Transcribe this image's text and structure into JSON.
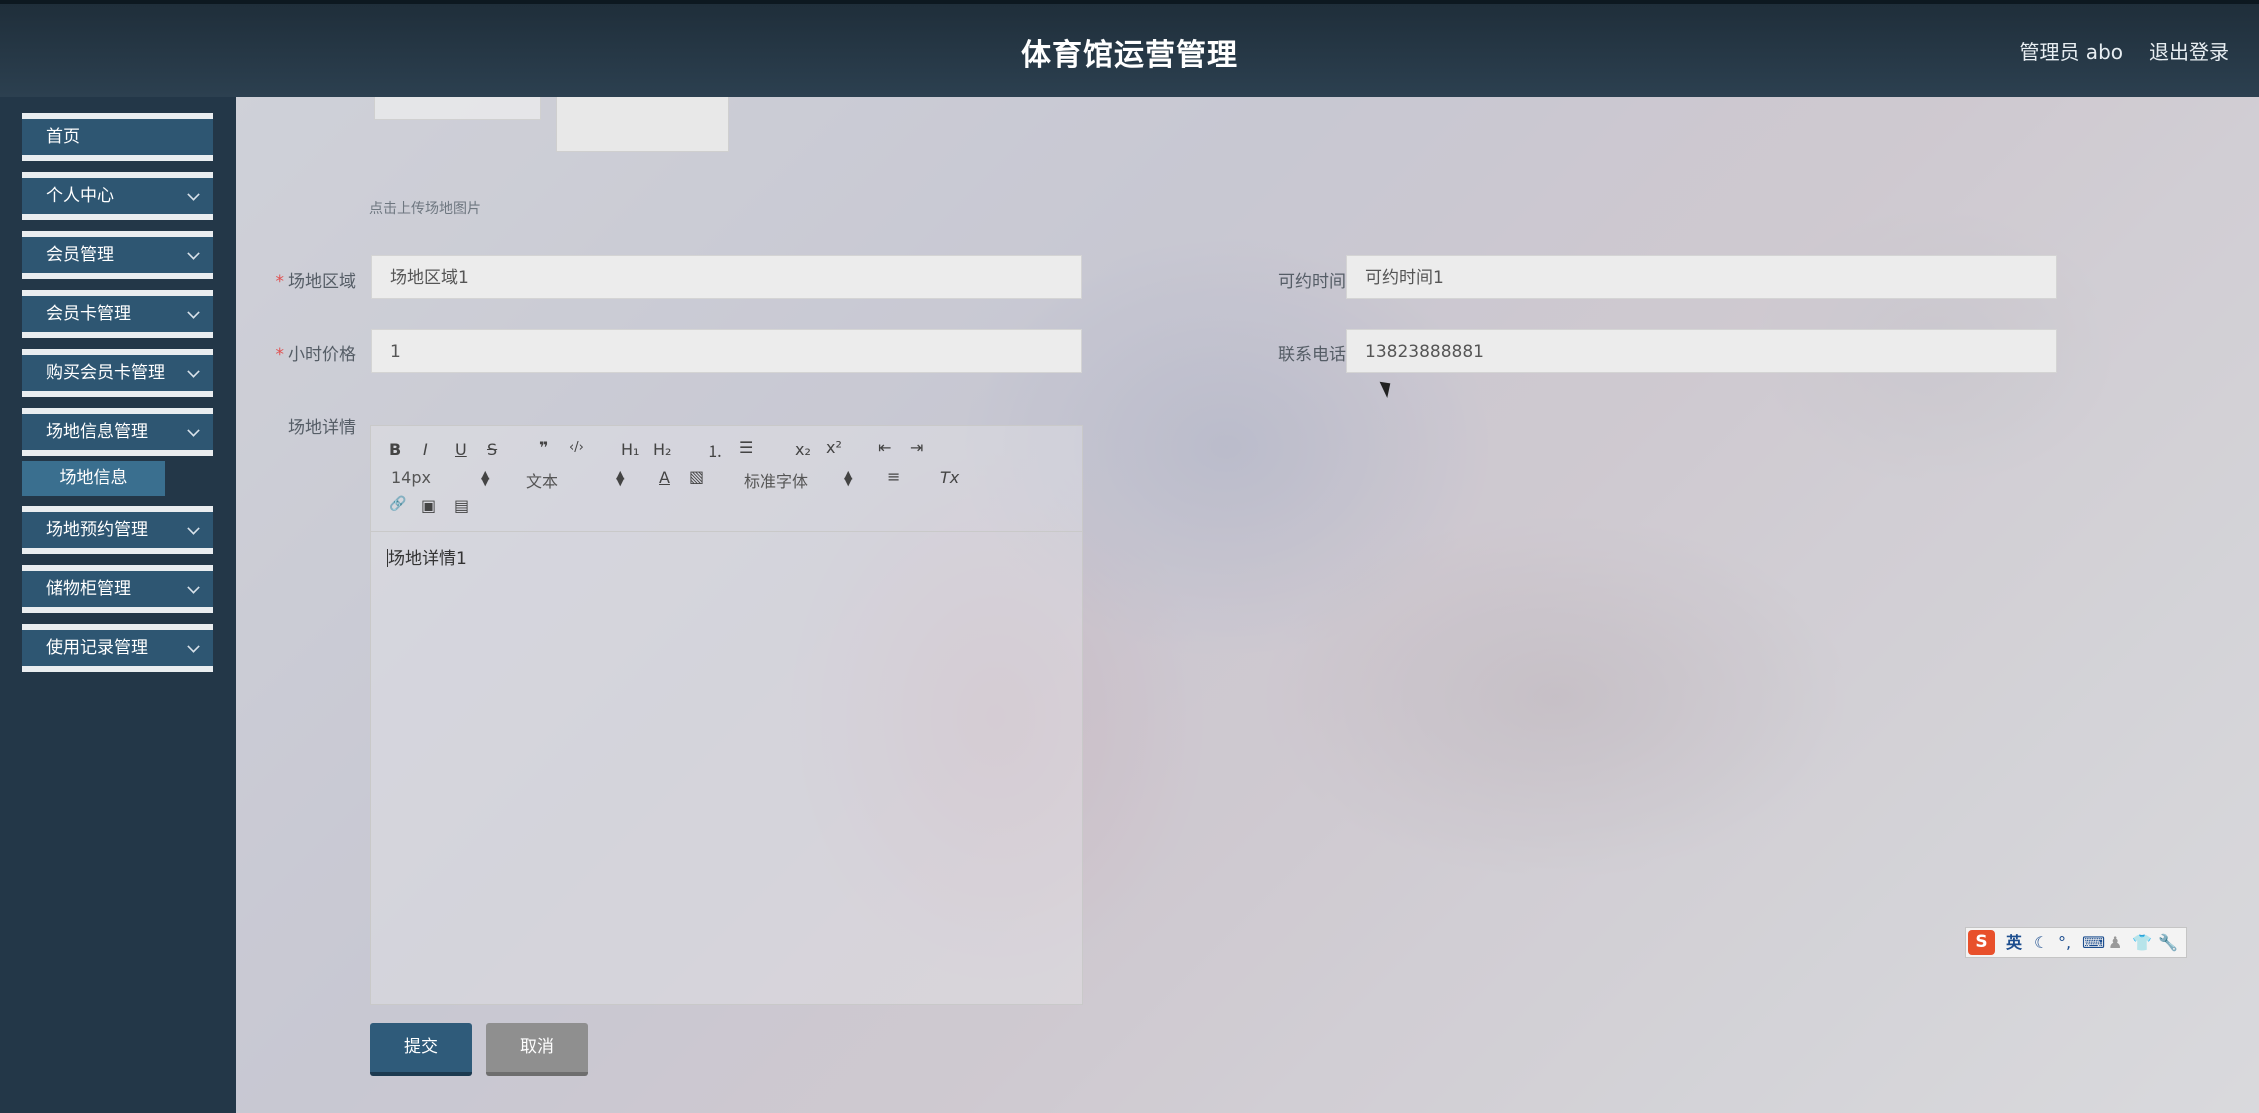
{
  "header": {
    "title": "体育馆运营管理",
    "user_label": "管理员 abo",
    "logout_label": "退出登录"
  },
  "sidebar": {
    "items": [
      {
        "label": "首页"
      },
      {
        "label": "个人中心"
      },
      {
        "label": "会员管理"
      },
      {
        "label": "会员卡管理"
      },
      {
        "label": "购买会员卡管理"
      },
      {
        "label": "场地信息管理"
      },
      {
        "label": "场地预约管理"
      },
      {
        "label": "储物柜管理"
      },
      {
        "label": "使用记录管理"
      }
    ],
    "sub_item": "场地信息"
  },
  "form": {
    "upload_hint": "点击上传场地图片",
    "area_label": "场地区域",
    "area_value": "场地区域1",
    "time_label": "可约时间",
    "time_value": "可约时间1",
    "price_label": "小时价格",
    "price_value": "1",
    "phone_label": "联系电话",
    "phone_value": "13823888881",
    "detail_label": "场地详情",
    "required_mark": "*"
  },
  "editor": {
    "font_size": "14px",
    "block_format": "文本",
    "font_family": "标准字体",
    "content": "场地详情1",
    "tools": {
      "bold": "B",
      "italic": "I",
      "underline": "U",
      "strike": "S",
      "quote": "❞",
      "code": "‹/›",
      "h1": "H₁",
      "h2": "H₂",
      "ol": "⒈",
      "ul": "☰",
      "sub": "x₂",
      "sup": "x²",
      "outdent": "⇤",
      "indent": "⇥",
      "color": "A",
      "bg": "▧",
      "align": "≡",
      "clear": "Tx",
      "link": "🔗",
      "image": "▣",
      "save": "▤"
    }
  },
  "buttons": {
    "submit": "提交",
    "cancel": "取消"
  },
  "ime": {
    "logo": "S",
    "mode": "英"
  }
}
